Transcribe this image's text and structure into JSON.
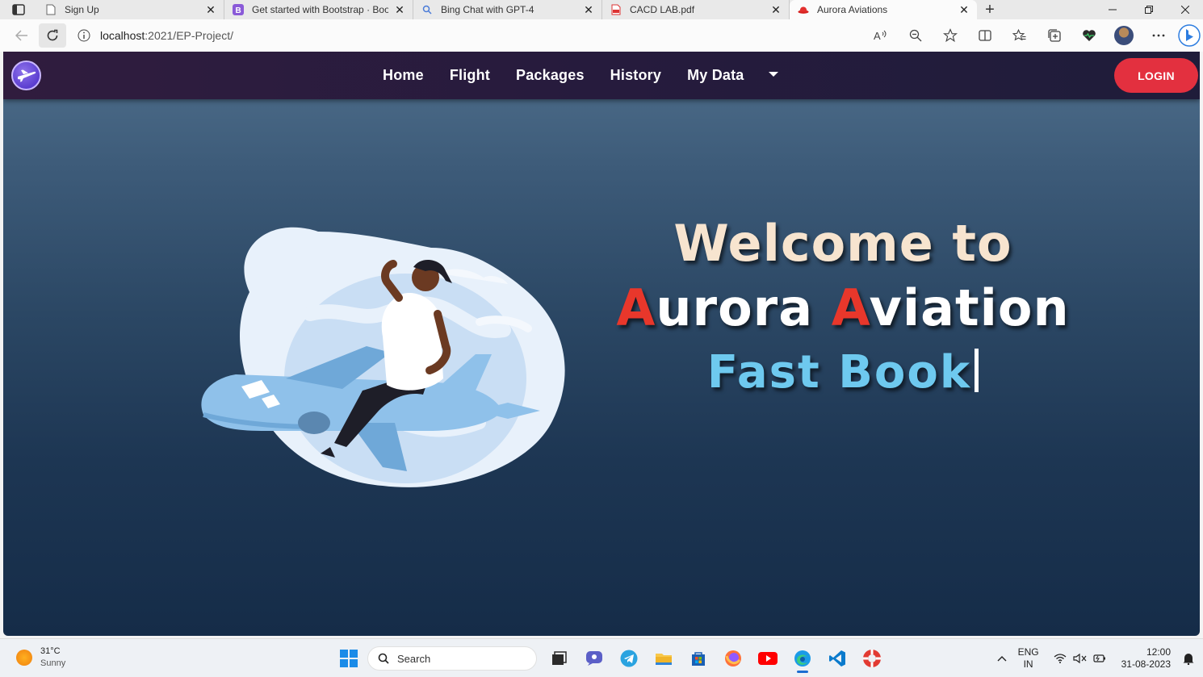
{
  "browser": {
    "tabs": [
      {
        "title": "Sign Up",
        "icon": "page-icon",
        "active": false
      },
      {
        "title": "Get started with Bootstrap · Boot",
        "icon": "bootstrap-icon",
        "active": false
      },
      {
        "title": "Bing Chat with GPT-4",
        "icon": "search-icon",
        "active": false
      },
      {
        "title": "CACD LAB.pdf",
        "icon": "pdf-icon",
        "active": false
      },
      {
        "title": "Aurora Aviations",
        "icon": "redhat-icon",
        "active": true
      }
    ],
    "url_host": "localhost",
    "url_rest": ":2021/EP-Project/"
  },
  "page": {
    "nav": {
      "links": [
        "Home",
        "Flight",
        "Packages",
        "History",
        "My Data"
      ],
      "login": "LOGIN"
    },
    "hero": {
      "line1": "Welcome to",
      "word1_cap": "A",
      "word1_rest": "urora ",
      "word2_cap": "A",
      "word2_rest": "viation",
      "line3": "Fast Book"
    },
    "colors": {
      "accent_red": "#e3303f",
      "headline_cream": "#f7e4cf",
      "headline_blue": "#6ec9ef",
      "navbar": "#261b3d"
    }
  },
  "taskbar": {
    "temp": "31°C",
    "condition": "Sunny",
    "search": "Search",
    "lang1": "ENG",
    "lang2": "IN",
    "time": "12:00",
    "date": "31-08-2023"
  }
}
